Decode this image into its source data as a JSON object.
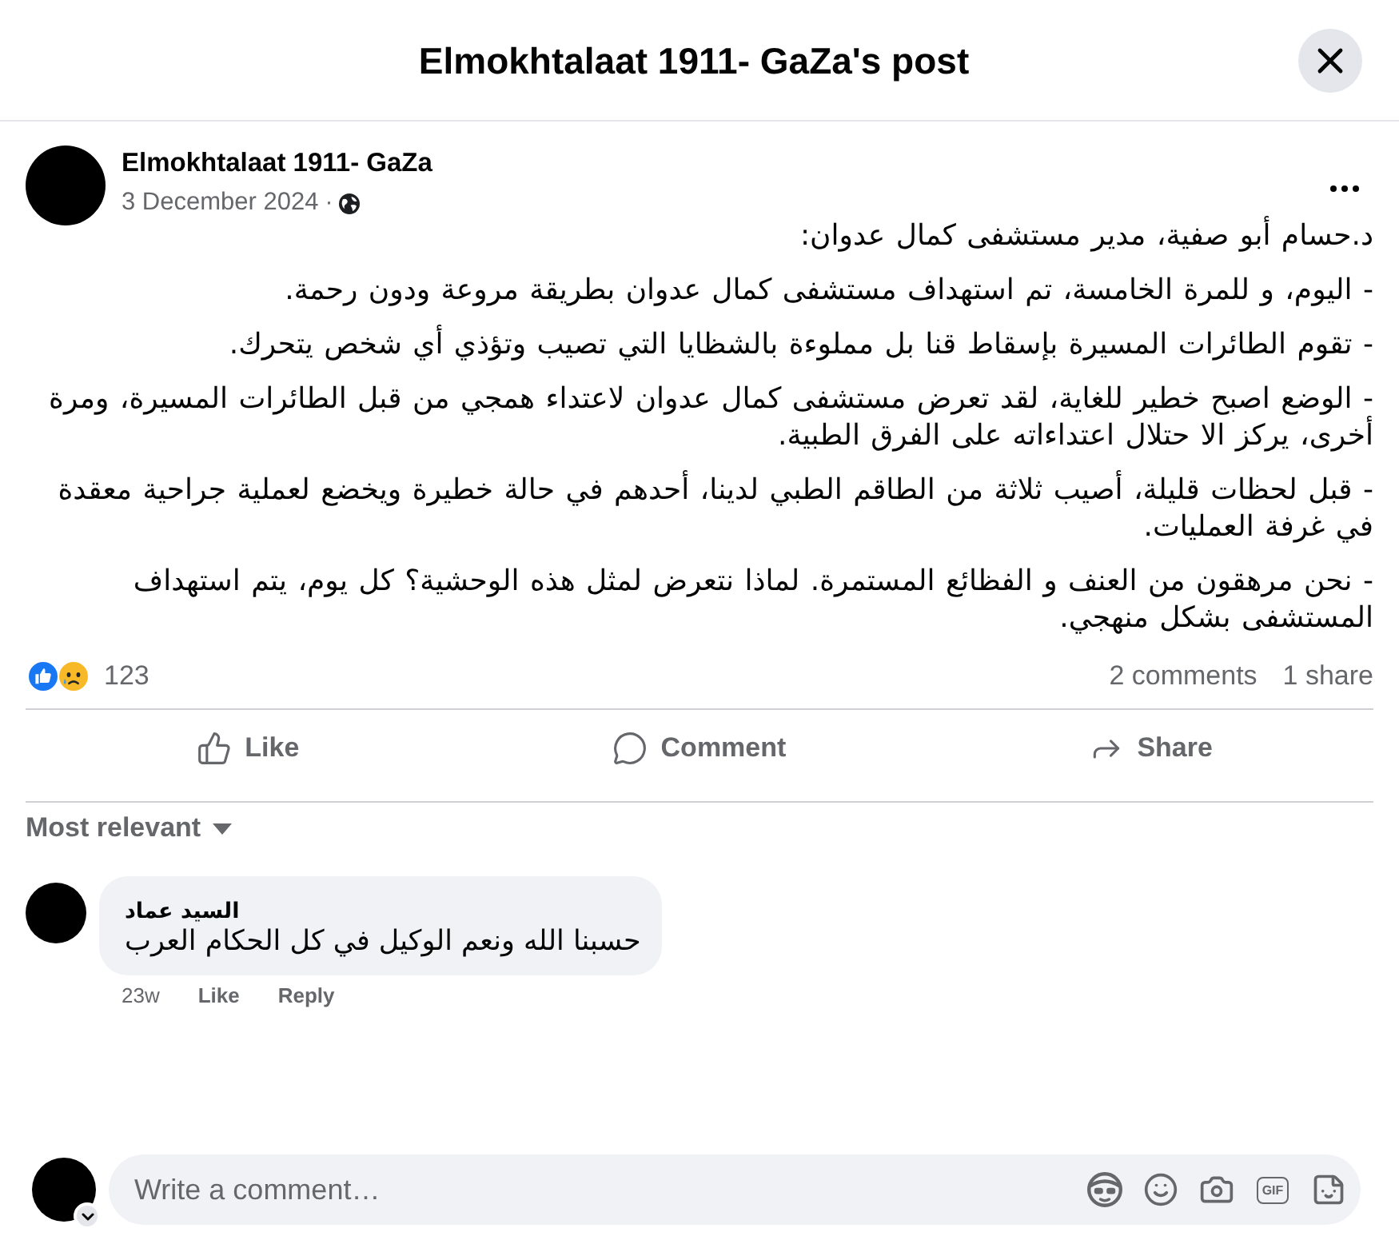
{
  "dialog": {
    "title": "Elmokhtalaat 1911- GaZa's post"
  },
  "post": {
    "author": "Elmokhtalaat 1911- GaZa",
    "date": "3 December 2024",
    "separator": "·",
    "paragraphs": [
      "د.حسام أبو صفية، مدير مستشفى كمال عدوان:",
      "- اليوم، و للمرة الخامسة، تم استهداف مستشفى كمال عدوان بطريقة مروعة ودون رحمة.",
      "- تقوم الطائرات المسيرة بإسقاط قنا بل مملوءة بالشظايا التي تصيب وتؤذي أي شخص يتحرك.",
      "- الوضع اصبح خطير للغاية، لقد تعرض مستشفى كمال عدوان لاعتداء همجي من قبل الطائرات المسيرة، ومرة أخرى، يركز الا حتلال اعتداءاته على الفرق الطبية.",
      "- قبل لحظات قليلة، أصيب ثلاثة من الطاقم الطبي لدينا، أحدهم في حالة خطيرة ويخضع لعملية جراحية معقدة في غرفة العمليات.",
      "- نحن مرهقون من العنف و الفظائع المستمرة. لماذا نتعرض لمثل هذه الوحشية؟ كل يوم، يتم استهداف المستشفى بشكل منهجي."
    ]
  },
  "reactions": {
    "types": [
      {
        "kind": "like"
      },
      {
        "kind": "sad"
      }
    ],
    "count": "123",
    "comments": "2 comments",
    "shares": "1 share"
  },
  "actions": {
    "like": "Like",
    "comment": "Comment",
    "share": "Share"
  },
  "sort": {
    "label": "Most relevant"
  },
  "comments": [
    {
      "author": "السيد عماد",
      "text": "حسبنا الله ونعم الوكيل في كل الحكام العرب",
      "time": "23w",
      "like": "Like",
      "reply": "Reply"
    }
  ],
  "composer": {
    "placeholder": "Write a comment…",
    "tools": [
      {
        "kind": "avatar"
      },
      {
        "kind": "emoji"
      },
      {
        "kind": "camera"
      },
      {
        "kind": "gif",
        "label": "GIF"
      },
      {
        "kind": "sticker"
      }
    ]
  }
}
